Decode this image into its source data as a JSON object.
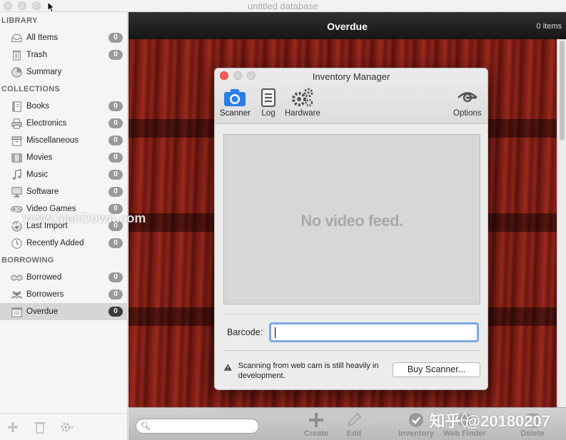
{
  "window": {
    "title": "untitled database"
  },
  "sidebar": {
    "library": {
      "title": "LIBRARY",
      "items": [
        {
          "label": "All Items",
          "count": "0",
          "icon": "tray-icon"
        },
        {
          "label": "Trash",
          "count": "0",
          "icon": "trash-icon"
        },
        {
          "label": "Summary",
          "count": "",
          "icon": "pie-chart-icon"
        }
      ]
    },
    "collections": {
      "title": "COLLECTIONS",
      "items": [
        {
          "label": "Books",
          "count": "0",
          "icon": "book-icon"
        },
        {
          "label": "Electronics",
          "count": "0",
          "icon": "printer-icon"
        },
        {
          "label": "Miscellaneous",
          "count": "0",
          "icon": "box-icon"
        },
        {
          "label": "Movies",
          "count": "0",
          "icon": "film-icon"
        },
        {
          "label": "Music",
          "count": "0",
          "icon": "music-note-icon"
        },
        {
          "label": "Software",
          "count": "0",
          "icon": "monitor-icon"
        },
        {
          "label": "Video Games",
          "count": "0",
          "icon": "gamepad-icon"
        },
        {
          "label": "Last Import",
          "count": "0",
          "icon": "import-icon"
        },
        {
          "label": "Recently Added",
          "count": "0",
          "icon": "clock-icon"
        }
      ]
    },
    "borrowing": {
      "title": "BORROWING",
      "items": [
        {
          "label": "Borrowed",
          "count": "0",
          "icon": "handshake-icon"
        },
        {
          "label": "Borrowers",
          "count": "0",
          "icon": "people-icon"
        },
        {
          "label": "Overdue",
          "count": "0",
          "icon": "calendar-icon",
          "selected": true
        }
      ]
    }
  },
  "main": {
    "title": "Overdue",
    "count": "0 items"
  },
  "toolbar": {
    "search_placeholder": "",
    "buttons": {
      "create": "Create",
      "edit": "Edit",
      "inventory": "Inventory",
      "web_finder": "Web Finder",
      "delete": "Delete"
    }
  },
  "dialog": {
    "title": "Inventory Manager",
    "tools": {
      "scanner": "Scanner",
      "log": "Log",
      "hardware": "Hardware",
      "options": "Options"
    },
    "video_message": "No video feed.",
    "barcode_label": "Barcode:",
    "barcode_value": "",
    "note": "Scanning from web cam is still heavily in development.",
    "buy_button": "Buy Scanner..."
  },
  "watermarks": {
    "left": "www.MacDown.com",
    "right": "知乎 @20180207"
  },
  "colors": {
    "accent": "#2a7ee8",
    "close_red": "#fc5f57",
    "shelf_wood": "#7d1d14"
  }
}
